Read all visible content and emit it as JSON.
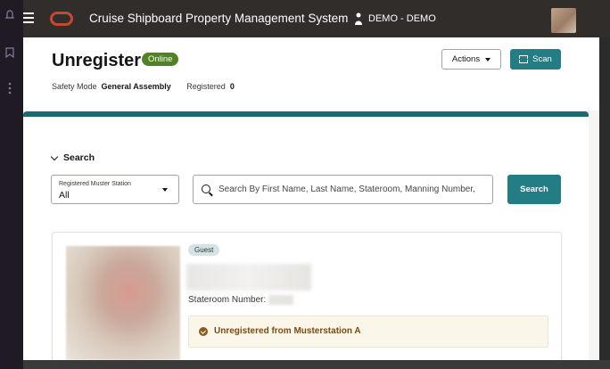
{
  "app": {
    "title": "Cruise Shipboard Property Management System",
    "user": "DEMO - DEMO"
  },
  "header": {
    "title": "Unregister",
    "status_badge": "Online",
    "safety_mode_label": "Safety Mode",
    "safety_mode_value": "General Assembly",
    "registered_label": "Registered",
    "registered_value": "0",
    "actions_label": "Actions",
    "scan_label": "Scan"
  },
  "search": {
    "toggle_label": "Search",
    "muster_label": "Registered Muster Station",
    "muster_value": "All",
    "placeholder": "Search By First Name, Last Name, Stateroom, Manning Number,",
    "button_label": "Search"
  },
  "result": {
    "type_badge": "Guest",
    "stateroom_label": "Stateroom Number:",
    "alert_text": "Unregistered from Musterstation A"
  },
  "colors": {
    "accent": "#227e84",
    "online": "#508223",
    "topbar": "#312d2a"
  }
}
